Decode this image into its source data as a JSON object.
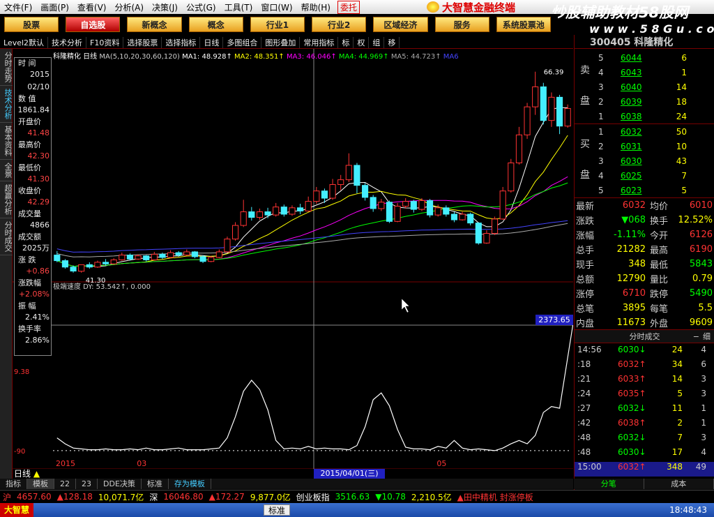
{
  "menubar": {
    "items": [
      "文件(F)",
      "画面(P)",
      "查看(V)",
      "分析(A)",
      "决策(J)",
      "公式(G)",
      "工具(T)",
      "窗口(W)",
      "帮助(H)"
    ],
    "entrust_label": "委托"
  },
  "brand": {
    "name": "大智慧金融终端"
  },
  "watermark": {
    "text": "炒股辅助教材58股网",
    "url": "w w w . 5 8 G u . c o m"
  },
  "navbar": {
    "buttons": [
      "股票",
      "自选股",
      "新概念",
      "概念",
      "行业1",
      "行业2",
      "区域经济",
      "服务",
      "系统股票池"
    ],
    "selected": "自选股"
  },
  "toolbar": {
    "items": [
      "Level2默认",
      "技术分析",
      "F10资料",
      "选择股票",
      "选择指标",
      "日线",
      "多图组合",
      "图形叠加",
      "常用指标",
      "标",
      "权",
      "组",
      "移"
    ]
  },
  "sidetabs": [
    "分时走势",
    "技术分析",
    "基本资料",
    "全景",
    "超赢分析",
    "分时成交"
  ],
  "databox": {
    "rows": [
      {
        "label": "时 间",
        "value": "2015"
      },
      {
        "label": "",
        "value": "02/10"
      },
      {
        "label": "数 值",
        "value": "1861.84"
      },
      {
        "label": "开盘价",
        "value": "41.48"
      },
      {
        "label": "最高价",
        "value": "42.30"
      },
      {
        "label": "最低价",
        "value": "41.30"
      },
      {
        "label": "收盘价",
        "value": "42.29"
      },
      {
        "label": "成交量",
        "value": "4866"
      },
      {
        "label": "成交额",
        "value": "2025万"
      },
      {
        "label": "涨 跌",
        "value": "+0.86"
      },
      {
        "label": "涨跌幅",
        "value": "+2.08%"
      },
      {
        "label": "振 幅",
        "value": "2.41%"
      },
      {
        "label": "换手率",
        "value": "2.86%"
      }
    ]
  },
  "ma_legend": {
    "title": "科隆精化 日线",
    "spec": "MA(5,10,20,30,60,120)",
    "ma1": "MA1: 48.928↑",
    "ma2": "MA2: 48.351↑",
    "ma3": "MA3: 46.046↑",
    "ma4": "MA4: 44.969↑",
    "ma5": "MA5: 44.723↑",
    "ma6": "MA6"
  },
  "ind_legend": {
    "text": "极端速度 DY: 53.542↑, 0.000"
  },
  "price_labels": {
    "high": "66.39",
    "low": "41.30"
  },
  "ind_axis": {
    "mid": "9.38",
    "low": "-90"
  },
  "crosshair": {
    "value": "2373.65",
    "date": "2015/04/01(三)"
  },
  "x_axis": {
    "labels": [
      "2015",
      "03",
      "05"
    ]
  },
  "period": {
    "label": "日线"
  },
  "bottomtabs": [
    "指标",
    "模板",
    "22",
    "23",
    "DDE决策",
    "标准",
    "存为模板"
  ],
  "panel": {
    "code": "300405",
    "name": "科隆精化",
    "sell": [
      {
        "lvl": "5",
        "price": "6044",
        "vol": "6"
      },
      {
        "lvl": "4",
        "price": "6043",
        "vol": "1"
      },
      {
        "lvl": "3",
        "price": "6040",
        "vol": "14"
      },
      {
        "lvl": "2",
        "price": "6039",
        "vol": "18"
      },
      {
        "lvl": "1",
        "price": "6038",
        "vol": "24"
      }
    ],
    "buy": [
      {
        "lvl": "1",
        "price": "6032",
        "vol": "50"
      },
      {
        "lvl": "2",
        "price": "6031",
        "vol": "10"
      },
      {
        "lvl": "3",
        "price": "6030",
        "vol": "43"
      },
      {
        "lvl": "4",
        "price": "6025",
        "vol": "7"
      },
      {
        "lvl": "5",
        "price": "6023",
        "vol": "5"
      }
    ],
    "sell_label": [
      "卖",
      "盘"
    ],
    "buy_label": [
      "买",
      "盘"
    ],
    "stats": [
      {
        "a": "最新",
        "b": "6032",
        "c": "均价",
        "d": "6010"
      },
      {
        "a": "涨跌",
        "b": "▼068",
        "c": "换手",
        "d": "12.52%"
      },
      {
        "a": "涨幅",
        "b": "-1.11%",
        "c": "今开",
        "d": "6126"
      },
      {
        "a": "总手",
        "b": "21282",
        "c": "最高",
        "d": "6190"
      },
      {
        "a": "现手",
        "b": "348",
        "c": "最低",
        "d": "5843"
      },
      {
        "a": "总额",
        "b": "12790",
        "c": "量比",
        "d": "0.79"
      },
      {
        "a": "涨停",
        "b": "6710",
        "c": "跌停",
        "d": "5490"
      },
      {
        "a": "总笔",
        "b": "3895",
        "c": "每笔",
        "d": "5.5"
      },
      {
        "a": "内盘",
        "b": "11673",
        "c": "外盘",
        "d": "9609"
      }
    ],
    "ticks_header": "分时成交",
    "ticks": [
      {
        "t": "14:56",
        "p": "6030↓",
        "v": "24",
        "n": "4"
      },
      {
        "t": ":18",
        "p": "6032↑",
        "v": "34",
        "n": "6"
      },
      {
        "t": ":21",
        "p": "6033↑",
        "v": "14",
        "n": "3"
      },
      {
        "t": ":24",
        "p": "6035↑",
        "v": "5",
        "n": "3"
      },
      {
        "t": ":27",
        "p": "6032↓",
        "v": "11",
        "n": "1"
      },
      {
        "t": ":42",
        "p": "6038↑",
        "v": "2",
        "n": "1"
      },
      {
        "t": ":48",
        "p": "6032↓",
        "v": "7",
        "n": "3"
      },
      {
        "t": ":48",
        "p": "6030↓",
        "v": "17",
        "n": "4"
      },
      {
        "t": "15:00",
        "p": "6032↑",
        "v": "348",
        "n": "49"
      }
    ],
    "tabs": [
      "分笔",
      "成本"
    ]
  },
  "statusbar": {
    "sh_label": "沪",
    "sh_index": "4657.60",
    "sh_change": "▲128.18",
    "sh_amount": "10,071.7亿",
    "sz_label": "深",
    "sz_index": "16046.80",
    "sz_change": "▲172.27",
    "sz_amount": "9,877.0亿",
    "cy_label": "创业板指",
    "cy_index": "3516.63",
    "cy_change": "▼10.78",
    "cy_amount": "2,210.5亿",
    "news": "▲田中精机 封涨停板"
  },
  "taskbar": {
    "start": "大智慧",
    "ime": "标准",
    "time": "18:48:43"
  },
  "chart_data": {
    "type": "candlestick",
    "title": "科隆精化 日线",
    "candles": [
      {
        "o": 43.5,
        "c": 42.8,
        "h": 44.0,
        "l": 42.6
      },
      {
        "o": 42.8,
        "c": 42.0,
        "h": 43.0,
        "l": 41.8
      },
      {
        "o": 42.0,
        "c": 41.5,
        "h": 42.2,
        "l": 41.3
      },
      {
        "o": 41.48,
        "c": 42.29,
        "h": 42.3,
        "l": 41.3
      },
      {
        "o": 42.3,
        "c": 42.0,
        "h": 42.6,
        "l": 41.8
      },
      {
        "o": 42.0,
        "c": 42.6,
        "h": 42.8,
        "l": 41.9
      },
      {
        "o": 42.6,
        "c": 42.4,
        "h": 43.0,
        "l": 42.2
      },
      {
        "o": 42.4,
        "c": 42.9,
        "h": 43.1,
        "l": 42.3
      },
      {
        "o": 42.9,
        "c": 43.5,
        "h": 43.8,
        "l": 42.8
      },
      {
        "o": 43.5,
        "c": 43.0,
        "h": 43.7,
        "l": 42.8
      },
      {
        "o": 43.0,
        "c": 43.4,
        "h": 43.6,
        "l": 42.9
      },
      {
        "o": 43.4,
        "c": 42.9,
        "h": 43.5,
        "l": 42.7
      },
      {
        "o": 42.9,
        "c": 43.6,
        "h": 43.9,
        "l": 42.8
      },
      {
        "o": 43.6,
        "c": 43.2,
        "h": 43.8,
        "l": 43.0
      },
      {
        "o": 43.2,
        "c": 43.8,
        "h": 44.1,
        "l": 43.1
      },
      {
        "o": 43.8,
        "c": 43.5,
        "h": 44.0,
        "l": 43.3
      },
      {
        "o": 43.5,
        "c": 43.9,
        "h": 44.2,
        "l": 43.4
      },
      {
        "o": 43.9,
        "c": 43.3,
        "h": 44.0,
        "l": 43.1
      },
      {
        "o": 43.3,
        "c": 42.7,
        "h": 43.5,
        "l": 42.5
      },
      {
        "o": 42.7,
        "c": 43.2,
        "h": 43.4,
        "l": 42.6
      },
      {
        "o": 43.2,
        "c": 43.9,
        "h": 44.2,
        "l": 43.1
      },
      {
        "o": 43.9,
        "c": 45.5,
        "h": 45.8,
        "l": 43.8
      },
      {
        "o": 45.5,
        "c": 47.2,
        "h": 47.6,
        "l": 45.3
      },
      {
        "o": 47.2,
        "c": 48.9,
        "h": 50.4,
        "l": 47.0
      },
      {
        "o": 48.9,
        "c": 48.2,
        "h": 49.5,
        "l": 47.8
      },
      {
        "o": 48.2,
        "c": 48.9,
        "h": 49.3,
        "l": 47.9
      },
      {
        "o": 48.9,
        "c": 48.5,
        "h": 49.4,
        "l": 48.1
      },
      {
        "o": 48.5,
        "c": 49.5,
        "h": 50.0,
        "l": 48.3
      },
      {
        "o": 49.5,
        "c": 48.6,
        "h": 49.8,
        "l": 48.3
      },
      {
        "o": 48.6,
        "c": 49.4,
        "h": 49.7,
        "l": 48.4
      },
      {
        "o": 49.4,
        "c": 49.0,
        "h": 49.9,
        "l": 48.6
      },
      {
        "o": 49.0,
        "c": 50.2,
        "h": 50.8,
        "l": 48.9
      },
      {
        "o": 50.2,
        "c": 51.5,
        "h": 52.0,
        "l": 49.9
      },
      {
        "o": 51.5,
        "c": 50.6,
        "h": 51.8,
        "l": 50.0
      },
      {
        "o": 50.6,
        "c": 52.3,
        "h": 53.0,
        "l": 50.4
      },
      {
        "o": 52.3,
        "c": 52.9,
        "h": 53.5,
        "l": 51.6
      },
      {
        "o": 52.9,
        "c": 54.7,
        "h": 56.2,
        "l": 52.6
      },
      {
        "o": 54.7,
        "c": 52.2,
        "h": 55.0,
        "l": 51.2
      },
      {
        "o": 52.2,
        "c": 50.7,
        "h": 52.5,
        "l": 50.3
      },
      {
        "o": 50.7,
        "c": 49.3,
        "h": 51.0,
        "l": 48.9
      },
      {
        "o": 49.3,
        "c": 50.1,
        "h": 50.5,
        "l": 49.0
      },
      {
        "o": 50.1,
        "c": 47.7,
        "h": 50.3,
        "l": 47.5
      },
      {
        "o": 47.7,
        "c": 49.6,
        "h": 50.0,
        "l": 47.6
      },
      {
        "o": 49.6,
        "c": 50.2,
        "h": 50.6,
        "l": 49.3
      },
      {
        "o": 50.2,
        "c": 49.2,
        "h": 50.4,
        "l": 48.8
      },
      {
        "o": 49.2,
        "c": 50.3,
        "h": 50.6,
        "l": 49.0
      },
      {
        "o": 50.3,
        "c": 48.5,
        "h": 50.5,
        "l": 48.2
      },
      {
        "o": 48.5,
        "c": 49.4,
        "h": 49.8,
        "l": 48.3
      },
      {
        "o": 49.4,
        "c": 48.6,
        "h": 49.7,
        "l": 48.3
      },
      {
        "o": 48.6,
        "c": 47.9,
        "h": 48.9,
        "l": 47.6
      },
      {
        "o": 47.9,
        "c": 48.6,
        "h": 48.9,
        "l": 47.8
      },
      {
        "o": 48.6,
        "c": 47.5,
        "h": 48.8,
        "l": 47.2
      },
      {
        "o": 47.5,
        "c": 45.0,
        "h": 47.6,
        "l": 44.8
      },
      {
        "o": 45.0,
        "c": 46.2,
        "h": 46.6,
        "l": 44.9
      },
      {
        "o": 46.2,
        "c": 48.0,
        "h": 48.3,
        "l": 46.0
      },
      {
        "o": 48.0,
        "c": 51.5,
        "h": 52.0,
        "l": 47.9
      },
      {
        "o": 51.5,
        "c": 55.0,
        "h": 55.5,
        "l": 51.3
      },
      {
        "o": 55.0,
        "c": 58.5,
        "h": 59.5,
        "l": 54.8
      },
      {
        "o": 58.5,
        "c": 62.0,
        "h": 62.5,
        "l": 58.0
      },
      {
        "o": 62.0,
        "c": 64.5,
        "h": 66.39,
        "l": 61.0
      },
      {
        "o": 64.5,
        "c": 60.3,
        "h": 65.0,
        "l": 59.8
      },
      {
        "o": 60.3,
        "c": 63.2,
        "h": 63.8,
        "l": 59.5
      },
      {
        "o": 63.2,
        "c": 59.6,
        "h": 63.5,
        "l": 58.6
      },
      {
        "o": 59.6,
        "c": 61.8,
        "h": 62.3,
        "l": 59.4
      }
    ],
    "ylim": [
      40.5,
      67.5
    ],
    "indicator": {
      "name": "极端速度 DY",
      "values": [
        1.5,
        0.8,
        0.3,
        0.2,
        0.1,
        0.1,
        0.2,
        0.1,
        0.1,
        0.2,
        0.1,
        0.3,
        0.1,
        0.1,
        0.2,
        0.3,
        0.1,
        0.1,
        0.1,
        0.2,
        0.3,
        1.5,
        4.0,
        7.0,
        8.3,
        7.2,
        4.8,
        1.2,
        0.2,
        0.3,
        0.2,
        0.5,
        0.2,
        0.3,
        0.2,
        0.2,
        0.1,
        0.6,
        2.8,
        6.0,
        6.8,
        5.3,
        2.5,
        0.4,
        0.2,
        0.2,
        0.1,
        0.5,
        0.3,
        1.2,
        0.3,
        0.1,
        0.2,
        0.1,
        0.0,
        0.3,
        0.8,
        1.2,
        0.8,
        1.8,
        4.5,
        5.2,
        5.0,
        11.0,
        17.0,
        17.5,
        12.0,
        6.0,
        0.1
      ],
      "ylim": [
        -1,
        19
      ]
    }
  }
}
